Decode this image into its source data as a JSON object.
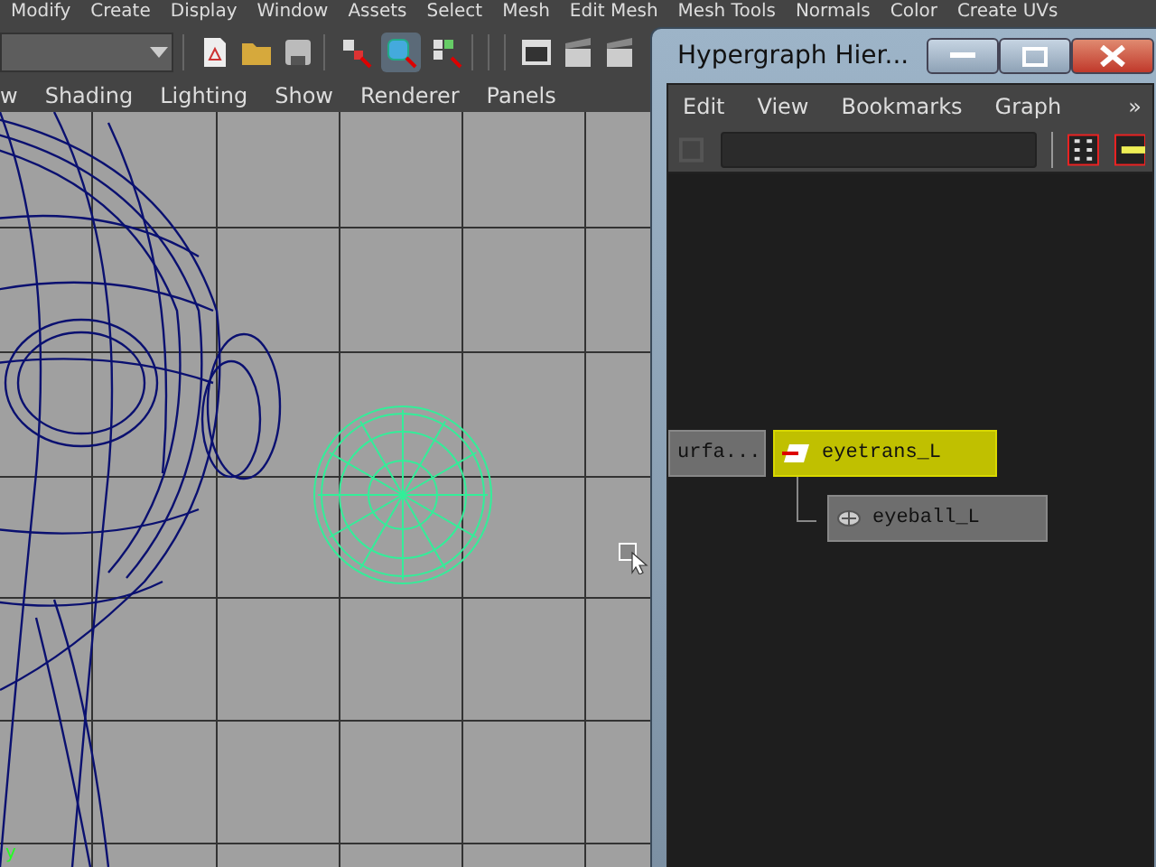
{
  "main_menu": [
    "Modify",
    "Create",
    "Display",
    "Window",
    "Assets",
    "Select",
    "Mesh",
    "Edit Mesh",
    "Mesh Tools",
    "Normals",
    "Color",
    "Create UVs"
  ],
  "panel_menu": [
    "w",
    "Shading",
    "Lighting",
    "Show",
    "Renderer",
    "Panels"
  ],
  "viewport": {
    "axis_label": "y"
  },
  "hypergraph": {
    "title": "Hypergraph Hier...",
    "menu": [
      "Edit",
      "View",
      "Bookmarks",
      "Graph"
    ],
    "overflow": "»",
    "nodes": [
      {
        "label": "urfa...",
        "kind": "plain",
        "selected": false
      },
      {
        "label": "eyetrans_L",
        "kind": "transform",
        "selected": true
      },
      {
        "label": "eyeball_L",
        "kind": "mesh",
        "selected": false
      }
    ]
  }
}
